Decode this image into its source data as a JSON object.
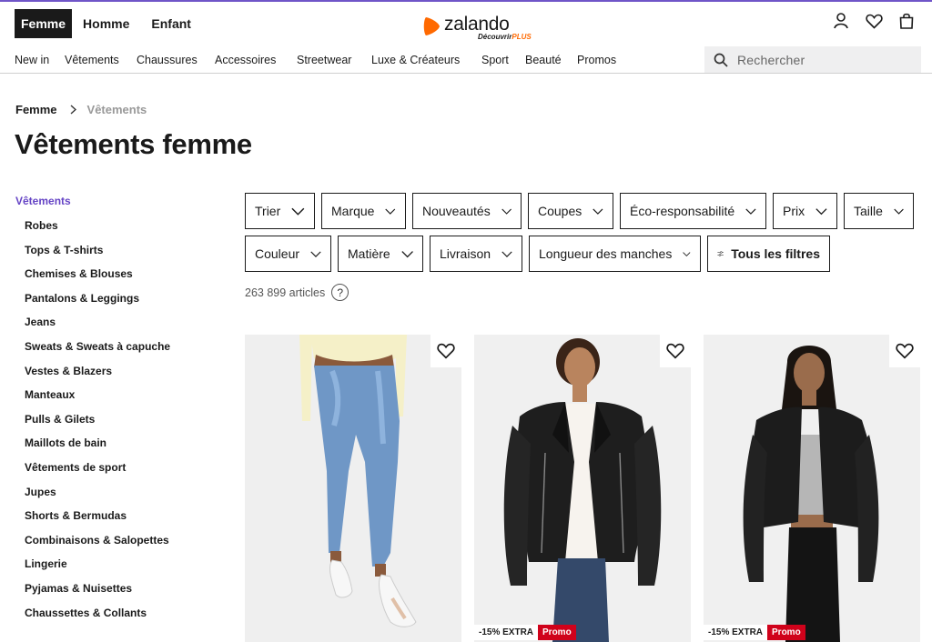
{
  "header": {
    "gender_tabs": [
      "Femme",
      "Homme",
      "Enfant"
    ],
    "logo_text": "zalando",
    "logo_subtext": "Découvrir",
    "logo_plus": "PLUS",
    "icons": [
      "user-icon",
      "heart-icon",
      "bag-icon"
    ],
    "categories": [
      "New in",
      "Vêtements",
      "Chaussures",
      "Accessoires",
      "Streetwear",
      "Luxe & Créateurs",
      "Sport",
      "Beauté",
      "Promos"
    ],
    "search_placeholder": "Rechercher"
  },
  "breadcrumb": {
    "parent": "Femme",
    "current": "Vêtements"
  },
  "page_title": "Vêtements femme",
  "sidebar": {
    "heading": "Vêtements",
    "items": [
      "Robes",
      "Tops & T-shirts",
      "Chemises & Blouses",
      "Pantalons & Leggings",
      "Jeans",
      "Sweats & Sweats à capuche",
      "Vestes & Blazers",
      "Manteaux",
      "Pulls & Gilets",
      "Maillots de bain",
      "Vêtements de sport",
      "Jupes",
      "Shorts & Bermudas",
      "Combinaisons & Salopettes",
      "Lingerie",
      "Pyjamas & Nuisettes",
      "Chaussettes & Collants"
    ]
  },
  "filters": {
    "row1": [
      "Trier",
      "Marque",
      "Nouveautés",
      "Coupes",
      "Éco-responsabilité",
      "Prix",
      "Taille"
    ],
    "row2": [
      "Couleur",
      "Matière",
      "Livraison",
      "Longueur des manches"
    ],
    "all_filters": "Tous les filtres"
  },
  "article_count": "263 899 articles",
  "help_icon_glyph": "?",
  "products": [
    {
      "image": "jeans-woman",
      "badge_extra": "",
      "badge_promo": ""
    },
    {
      "image": "leather-jacket-woman",
      "badge_extra": "-15% EXTRA",
      "badge_promo": "Promo"
    },
    {
      "image": "leather-jacket-woman-2",
      "badge_extra": "-15% EXTRA",
      "badge_promo": "Promo"
    }
  ],
  "colors": {
    "accent": "#6544c5",
    "promo": "#d0021b",
    "brand_orange": "#ff6900"
  }
}
